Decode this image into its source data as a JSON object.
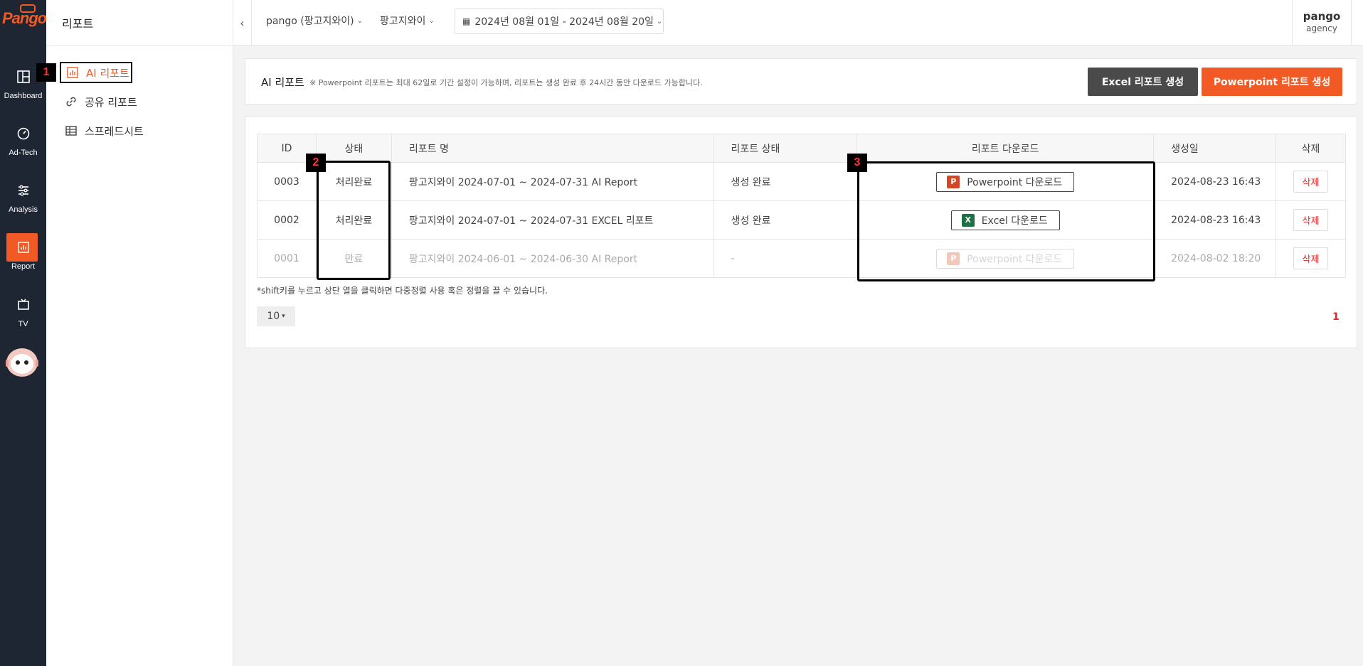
{
  "brand": {
    "logo_text": "Pango",
    "accent": "#f15a24"
  },
  "rail": {
    "items": [
      {
        "label": "Dashboard",
        "icon": "dashboard-icon"
      },
      {
        "label": "Ad-Tech",
        "icon": "gauge-icon"
      },
      {
        "label": "Analysis",
        "icon": "sliders-icon"
      },
      {
        "label": "Report",
        "icon": "report-icon",
        "active": true
      },
      {
        "label": "TV",
        "icon": "tv-icon"
      }
    ]
  },
  "sidebar": {
    "title": "리포트",
    "items": [
      {
        "label": "AI 리포트",
        "icon": "chart-icon",
        "active": true
      },
      {
        "label": "공유 리포트",
        "icon": "link-icon"
      },
      {
        "label": "스프레드시트",
        "icon": "table-icon"
      }
    ]
  },
  "topbar": {
    "account": "pango (팡고지와이)",
    "advertiser": "팡고지와이",
    "date_range": "2024년 08월 01일 - 2024년 08월 20일",
    "user_name": "pango",
    "user_role": "agency"
  },
  "header": {
    "title": "AI 리포트",
    "note": "※ Powerpoint 리포트는 최대 62일로 기간 설정이 가능하며, 리포트는 생성 완료 후 24시간 동안 다운로드 가능합니다.",
    "excel_button": "Excel 리포트 생성",
    "ppt_button": "Powerpoint 리포트 생성"
  },
  "table": {
    "columns": [
      "ID",
      "상태",
      "리포트 명",
      "리포트 상태",
      "리포트 다운로드",
      "생성일",
      "삭제"
    ],
    "rows": [
      {
        "id": "0003",
        "status": "처리완료",
        "name": "팡고지와이 2024-07-01 ~ 2024-07-31 AI Report",
        "report_status": "생성 완료",
        "download": "Powerpoint 다운로드",
        "download_type": "ppt",
        "created": "2024-08-23 16:43",
        "delete": "삭제"
      },
      {
        "id": "0002",
        "status": "처리완료",
        "name": "팡고지와이 2024-07-01 ~ 2024-07-31 EXCEL 리포트",
        "report_status": "생성 완료",
        "download": "Excel 다운로드",
        "download_type": "excel",
        "created": "2024-08-23 16:43",
        "delete": "삭제"
      },
      {
        "id": "0001",
        "status": "만료",
        "name": "팡고지와이 2024-06-01 ~ 2024-06-30 AI Report",
        "report_status": "-",
        "download": "Powerpoint 다운로드",
        "download_type": "ppt",
        "created": "2024-08-02 18:20",
        "delete": "삭제",
        "expired": true
      }
    ],
    "shift_note": "*shift키를 누르고 상단 열을 클릭하면 다중정렬 사용 혹은 정렬을 끌 수 있습니다.",
    "page_size": "10",
    "current_page": "1"
  },
  "annotations": {
    "badge1": "1",
    "badge2": "2",
    "badge3": "3"
  }
}
